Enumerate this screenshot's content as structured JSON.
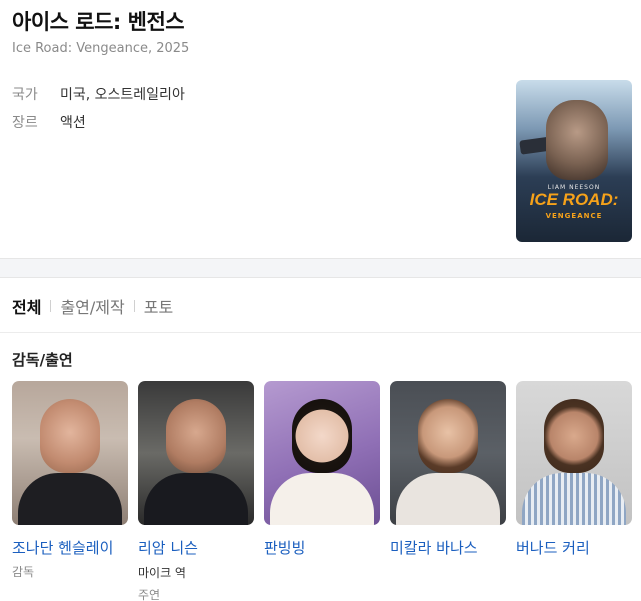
{
  "header": {
    "title": "아이스 로드: 벤전스",
    "subtitle": "Ice Road: Vengeance, 2025"
  },
  "info": [
    {
      "key": "국가",
      "value": "미국, 오스트레일리아"
    },
    {
      "key": "장르",
      "value": "액션"
    }
  ],
  "poster": {
    "actor": "LIAM NEESON",
    "logo": "ICE ROAD:",
    "logo_sub": "VENGEANCE"
  },
  "tabs": [
    {
      "label": "전체",
      "active": true
    },
    {
      "label": "출연/제작",
      "active": false
    },
    {
      "label": "포토",
      "active": false
    }
  ],
  "section": {
    "title": "감독/출연"
  },
  "cast": [
    {
      "name": "조나단 헨슬레이",
      "role": "",
      "part": "감독"
    },
    {
      "name": "리암 니슨",
      "role": "마이크 역",
      "part": "주연"
    },
    {
      "name": "판빙빙",
      "role": "",
      "part": ""
    },
    {
      "name": "미칼라 바나스",
      "role": "",
      "part": ""
    },
    {
      "name": "버나드 커리",
      "role": "",
      "part": ""
    }
  ],
  "colors": {
    "link": "#1b5fbf",
    "muted": "#8a8a8a",
    "band": "#f4f5f7"
  }
}
